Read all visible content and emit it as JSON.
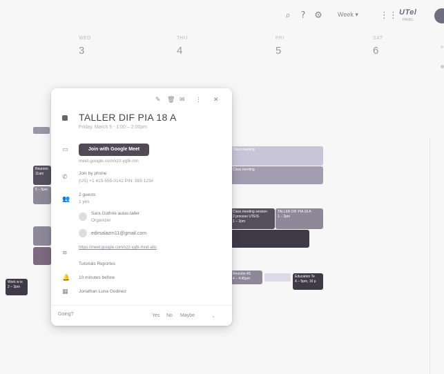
{
  "topbar": {
    "icons": [
      "search-icon",
      "help-icon",
      "settings-icon",
      "apps-icon"
    ],
    "view_label": "Week",
    "logo_text": "UTel",
    "logo_sub": "PANEL"
  },
  "days": [
    {
      "name": "WED",
      "num": "3"
    },
    {
      "name": "THU",
      "num": "4"
    },
    {
      "name": "FRI",
      "num": "5"
    },
    {
      "name": "SAT",
      "num": "6"
    }
  ],
  "events": {
    "fri_1": "Class meeting",
    "fri_2": "Class meeting",
    "fri_3_title": "Class meeting session",
    "fri_3_sub": "2 proceso UTEIS",
    "fri_3_time": "1 – 2pm",
    "fri_4_title": "TALLER DIF PIA 18 A",
    "fri_4_time": "1 – 2pm",
    "fri_5": "Reunión 4S",
    "fri_5_time": "4 – 4:45pm",
    "sat_1": "Education Te",
    "sat_1_time": "4 – 5pm, 16 p",
    "left_1": "Reunion",
    "left_1_time": "11am",
    "left_2": "5 – 5pm",
    "left_3": "Work w is",
    "left_3_time": "2 – 3pm"
  },
  "popup": {
    "actions": [
      "edit-icon",
      "delete-icon",
      "email-icon",
      "more-icon",
      "close-icon"
    ],
    "title": "TALLER DIF PIA 18 A",
    "subtitle": "Friday, March 5 ⋅ 1:00 – 2:00pm",
    "meet_button": "Join with Google Meet",
    "meet_link": "meet.google.com/xzz-ygtk-mn",
    "phone_label": "Join by phone",
    "phone_number": "(US) +1 415-555-0142 PIN: 555 123#",
    "guests_count": "2 guests",
    "guests_sub": "1 yes",
    "guest_1": "Sara Guthrie aulas.taller",
    "guest_1_role": "Organizer",
    "guest_2": "edirsalazm11@gmail.com",
    "description_link": "https://meet.google.com/xzz-ygtk-mnd-abc",
    "organizer": "Tutorials Reportes",
    "reminder": "10 minutes before",
    "calendar": "Jonathan Luna Godinez",
    "rsvp_label": "Going?",
    "rsvp_options": [
      "Yes",
      "No",
      "Maybe"
    ]
  }
}
